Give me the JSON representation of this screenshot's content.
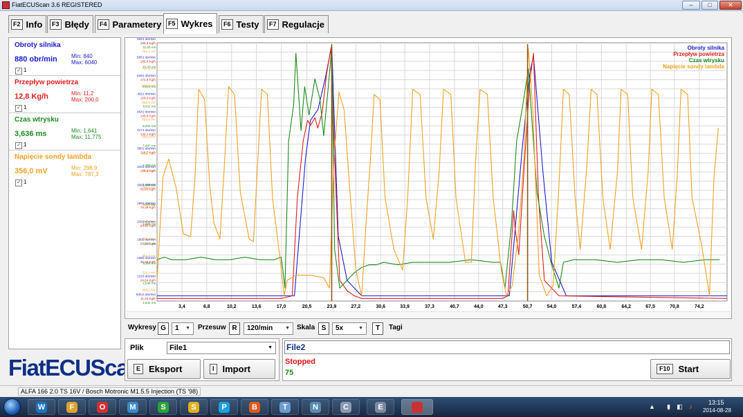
{
  "window": {
    "title": "FiatECUScan 3.6 REGISTERED",
    "controls": {
      "minimize": "–",
      "maximize": "□",
      "close": "✕"
    }
  },
  "tabs": [
    {
      "key": "F2",
      "label": "Info"
    },
    {
      "key": "F3",
      "label": "Błędy"
    },
    {
      "key": "F4",
      "label": "Parametery"
    },
    {
      "key": "F5",
      "label": "Wykres",
      "active": true
    },
    {
      "key": "F6",
      "label": "Testy"
    },
    {
      "key": "F7",
      "label": "Regulacje"
    }
  ],
  "params": [
    {
      "name": "Obroty silnika",
      "value": "880 obr/min",
      "min": "Min: 840",
      "max": "Max: 6040",
      "check": "✓",
      "index": "1",
      "color": "#1a1acc"
    },
    {
      "name": "Przepływ powietrza",
      "value": "12,8 Kg/h",
      "min": "Min: 11,2",
      "max": "Max: 200,0",
      "check": "✓",
      "index": "1",
      "color": "#e01c1c"
    },
    {
      "name": "Czas wtrysku",
      "value": "3,636 ms",
      "min": "Min: 1,641",
      "max": "Max: 11,775",
      "check": "✓",
      "index": "1",
      "color": "#1a8a1a"
    },
    {
      "name": "Napięcie sondy lambda",
      "value": "356,0 mV",
      "min": "Min: 298,9",
      "max": "Max: 787,3",
      "check": "✓",
      "index": "1",
      "color": "#f0a020"
    }
  ],
  "logo": "FiatECUScan",
  "chart_data": {
    "type": "line",
    "x_ticks": [
      "3,4",
      "6,8",
      "10,2",
      "13,6",
      "17,0",
      "20,5",
      "23,9",
      "27,2",
      "30,6",
      "33,9",
      "37,3",
      "40,7",
      "44,0",
      "47,3",
      "50,7",
      "54,0",
      "57,4",
      "60,8",
      "64,2",
      "67,5",
      "70,8",
      "74,2"
    ],
    "xlim": [
      0,
      78
    ],
    "y_axis": {
      "rpm": [
        "840,0 obr/min",
        "1210 obr/min",
        "1580 obr/min",
        "1950 obr/min",
        "2320 obr/min",
        "2691 obr/min",
        "3061 obr/min",
        "3431 obr/min",
        "3801 obr/min",
        "4171 obr/min",
        "4541 obr/min",
        "4911 obr/min",
        "5281 obr/min",
        "5651 obr/min",
        "6021 obr/min"
      ],
      "air": [
        "11,20 Kg/h",
        "24,64 Kg/h",
        "38,08 Kg/h",
        "51,51 Kg/h",
        "64,95 Kg/h",
        "78,39 Kg/h",
        "91,83 Kg/h",
        "105,3 Kg/h",
        "118,7 Kg/h",
        "132,1 Kg/h",
        "145,6 Kg/h",
        "159,0 Kg/h",
        "172,5 Kg/h",
        "185,9 Kg/h",
        "199,3 Kg/h"
      ],
      "inj": [
        "1,641 ms",
        "2,548 ms",
        "3,256 ms",
        "3,962 ms",
        "4,669 ms",
        "5,376 ms",
        "6,083 ms",
        "6,790 ms",
        "7,497 ms",
        "8,204 ms",
        "8,911 ms",
        "9,619 ms",
        "10,33 ms",
        "11,03 ms"
      ],
      "lambda": [
        "250,1 mV",
        "284,2 mV",
        "318,2 mV",
        "352,3 mV",
        "386,4 mV",
        "420,4 mV",
        "454,5 mV",
        "488,6 mV",
        "522,6 mV",
        "556,7 mV",
        "590,8 mV",
        "624,9 mV",
        "658,9 mV",
        "693,0 mV",
        "727,1 mV",
        "761,1 mV"
      ]
    },
    "legend": [
      "Obroty silnika",
      "Przepływ powietrza",
      "Czas wtrysku",
      "Napięcie sondy lambda"
    ],
    "legend_position": "top-right",
    "grid": true,
    "series": [
      {
        "name": "Obroty silnika",
        "color": "#1a1acc",
        "points": [
          [
            0,
            0.02
          ],
          [
            17,
            0.02
          ],
          [
            18.8,
            0.02
          ],
          [
            20.3,
            0.55
          ],
          [
            21,
            0.7
          ],
          [
            22,
            0.74
          ],
          [
            23,
            0.86
          ],
          [
            23.9,
            0.99
          ],
          [
            24.8,
            0.25
          ],
          [
            26,
            0.08
          ],
          [
            28,
            0.02
          ],
          [
            47,
            0.02
          ],
          [
            48.2,
            0.02
          ],
          [
            50,
            0.6
          ],
          [
            51,
            0.88
          ],
          [
            51.5,
            0.95
          ],
          [
            52.8,
            0.5
          ],
          [
            54,
            0.15
          ],
          [
            56,
            0.02
          ],
          [
            78,
            0.02
          ]
        ]
      },
      {
        "name": "Przepływ powietrza",
        "color": "#e01c1c",
        "points": [
          [
            0,
            0.01
          ],
          [
            17,
            0.01
          ],
          [
            18.5,
            0.02
          ],
          [
            19.2,
            0.4
          ],
          [
            20,
            0.62
          ],
          [
            20.6,
            0.7
          ],
          [
            21,
            0.68
          ],
          [
            21.6,
            0.71
          ],
          [
            22,
            0.67
          ],
          [
            22.6,
            0.73
          ],
          [
            23.2,
            0.88
          ],
          [
            23.8,
            0.98
          ],
          [
            24.3,
            0.55
          ],
          [
            25,
            0.08
          ],
          [
            26,
            0.04
          ],
          [
            27,
            0.02
          ],
          [
            28,
            0.01
          ],
          [
            47.3,
            0.01
          ],
          [
            48,
            0.02
          ],
          [
            48.8,
            0.35
          ],
          [
            49,
            0.28
          ],
          [
            49.5,
            0.18
          ],
          [
            50.2,
            0.5
          ],
          [
            51,
            0.85
          ],
          [
            51.5,
            0.96
          ],
          [
            52.2,
            0.4
          ],
          [
            53,
            0.08
          ],
          [
            55,
            0.02
          ],
          [
            78,
            0.01
          ]
        ]
      },
      {
        "name": "Czas wtrysku",
        "color": "#1a8a1a",
        "points": [
          [
            0,
            0.16
          ],
          [
            1,
            0.17
          ],
          [
            2,
            0.16
          ],
          [
            4,
            0.16
          ],
          [
            6,
            0.17
          ],
          [
            8,
            0.16
          ],
          [
            10,
            0.16
          ],
          [
            12,
            0.17
          ],
          [
            14,
            0.16
          ],
          [
            16,
            0.16
          ],
          [
            17,
            0.17
          ],
          [
            17.5,
            0.05
          ],
          [
            18,
            0.62
          ],
          [
            18.7,
            0.76
          ],
          [
            19,
            0.96
          ],
          [
            19.7,
            0.66
          ],
          [
            20.2,
            0.83
          ],
          [
            20.8,
            0.72
          ],
          [
            21.6,
            0.86
          ],
          [
            22.3,
            0.78
          ],
          [
            22.8,
            0.64
          ],
          [
            23.4,
            0.82
          ],
          [
            23.9,
            0.98
          ],
          [
            24.3,
            0.2
          ],
          [
            25,
            0.05
          ],
          [
            26,
            0.08
          ],
          [
            27,
            0.11
          ],
          [
            28,
            0.13
          ],
          [
            29,
            0.14
          ],
          [
            30,
            0.14
          ],
          [
            31,
            0.15
          ],
          [
            33,
            0.14
          ],
          [
            35,
            0.15
          ],
          [
            37,
            0.15
          ],
          [
            40,
            0.15
          ],
          [
            43,
            0.16
          ],
          [
            46,
            0.15
          ],
          [
            47,
            0.15
          ],
          [
            47.6,
            0.05
          ],
          [
            48.5,
            0.3
          ],
          [
            49.2,
            0.62
          ],
          [
            50,
            0.75
          ],
          [
            50.8,
            0.9
          ],
          [
            51.3,
            0.7
          ],
          [
            52,
            0.42
          ],
          [
            53,
            0.25
          ],
          [
            54,
            0.14
          ],
          [
            55,
            0.05
          ],
          [
            55.6,
            0.15
          ],
          [
            57,
            0.16
          ],
          [
            60,
            0.16
          ],
          [
            63,
            0.15
          ],
          [
            66,
            0.16
          ],
          [
            69,
            0.16
          ],
          [
            72,
            0.15
          ],
          [
            75,
            0.16
          ],
          [
            77,
            0.16
          ]
        ]
      },
      {
        "name": "Napięcie sondy lambda",
        "color": "#f0a020",
        "points": [
          [
            0,
            0.08
          ],
          [
            0.8,
            0.48
          ],
          [
            1.6,
            0.55
          ],
          [
            2.6,
            0.44
          ],
          [
            3.6,
            0.26
          ],
          [
            4.6,
            0.25
          ],
          [
            5.2,
            0.48
          ],
          [
            5.7,
            0.82
          ],
          [
            6.5,
            0.78
          ],
          [
            7.2,
            0.45
          ],
          [
            7.8,
            0.3
          ],
          [
            8.6,
            0.24
          ],
          [
            9.2,
            0.52
          ],
          [
            9.8,
            0.83
          ],
          [
            10.6,
            0.8
          ],
          [
            11.4,
            0.42
          ],
          [
            12.6,
            0.24
          ],
          [
            13.2,
            0.23
          ],
          [
            13.8,
            0.55
          ],
          [
            14.3,
            0.82
          ],
          [
            15.1,
            0.8
          ],
          [
            15.8,
            0.4
          ],
          [
            16.8,
            0.17
          ],
          [
            17.4,
            0.02
          ],
          [
            17.8,
            0.08
          ],
          [
            19,
            0.1
          ],
          [
            21,
            0.1
          ],
          [
            22.8,
            0.09
          ],
          [
            23.6,
            0.05
          ],
          [
            24.2,
            0.55
          ],
          [
            24.9,
            0.81
          ],
          [
            25.6,
            0.74
          ],
          [
            26.2,
            0.5
          ],
          [
            27.2,
            0.12
          ],
          [
            28,
            0.02
          ],
          [
            28.6,
            0.3
          ],
          [
            29.2,
            0.55
          ],
          [
            29.7,
            0.8
          ],
          [
            30.5,
            0.78
          ],
          [
            31.2,
            0.4
          ],
          [
            32.4,
            0.2
          ],
          [
            33.6,
            0.12
          ],
          [
            34.3,
            0.4
          ],
          [
            35,
            0.82
          ],
          [
            36,
            0.8
          ],
          [
            36.8,
            0.4
          ],
          [
            37.8,
            0.24
          ],
          [
            38.6,
            0.5
          ],
          [
            39.2,
            0.82
          ],
          [
            40.2,
            0.8
          ],
          [
            40.9,
            0.4
          ],
          [
            42.2,
            0.15
          ],
          [
            43,
            0.15
          ],
          [
            43.6,
            0.55
          ],
          [
            44.2,
            0.82
          ],
          [
            45.2,
            0.8
          ],
          [
            46,
            0.4
          ],
          [
            47.1,
            0.12
          ],
          [
            47.8,
            0.02
          ],
          [
            48.6,
            0.06
          ],
          [
            49.4,
            0.25
          ],
          [
            50.2,
            0.55
          ],
          [
            50.8,
            0.98
          ],
          [
            51.4,
            0.75
          ],
          [
            52.3,
            0.1
          ],
          [
            53.3,
            0.02
          ],
          [
            54.2,
            0.06
          ],
          [
            55,
            0.45
          ],
          [
            55.6,
            0.82
          ],
          [
            56.4,
            0.8
          ],
          [
            57.2,
            0.4
          ],
          [
            57.9,
            0.2
          ],
          [
            58.8,
            0.52
          ],
          [
            59.4,
            0.82
          ],
          [
            60.2,
            0.8
          ],
          [
            61,
            0.4
          ],
          [
            62,
            0.2
          ],
          [
            63,
            0.5
          ],
          [
            63.5,
            0.82
          ],
          [
            64.4,
            0.8
          ],
          [
            65.1,
            0.4
          ],
          [
            66.3,
            0.2
          ],
          [
            67.2,
            0.5
          ],
          [
            67.7,
            0.82
          ],
          [
            68.6,
            0.8
          ],
          [
            69.4,
            0.4
          ],
          [
            70.5,
            0.2
          ],
          [
            71.2,
            0.5
          ],
          [
            71.7,
            0.82
          ],
          [
            72.6,
            0.8
          ],
          [
            73.2,
            0.4
          ],
          [
            74.5,
            0.22
          ],
          [
            75.6,
            0.02
          ],
          [
            76.2,
            0.48
          ],
          [
            76.8,
            0.67
          ]
        ]
      }
    ]
  },
  "toolbar": {
    "wykresy_label": "Wykresy",
    "wykresy_key": "G",
    "wykresy_value": "1",
    "przesuw_label": "Przesuw",
    "przesuw_key": "R",
    "przesuw_value": "120/min",
    "skala_label": "Skala",
    "skala_key": "S",
    "skala_value": "5x",
    "tagi_key": "T",
    "tagi_label": "Tagi",
    "dropdown_arrow": "▼"
  },
  "file": {
    "label": "Plik",
    "selected": "File1",
    "export_key": "E",
    "export_label": "Eksport",
    "import_key": "I",
    "import_label": "Import"
  },
  "status": {
    "file2": "File2",
    "state": "Stopped",
    "count": "75",
    "start_key": "F10",
    "start_label": "Start"
  },
  "statusbar": {
    "text": "ALFA 166 2.0 TS 16V / Bosch Motronic M1.5.5 Injection (TS '98)"
  },
  "taskbar": {
    "items": [
      "W",
      "F",
      "O",
      "M",
      "S",
      "S",
      "P",
      "B",
      "T",
      "N",
      "C",
      "E"
    ],
    "clock_time": "13:15",
    "clock_date": "2014-08-28",
    "tray": [
      "▲",
      "▮",
      "◧",
      "♪"
    ]
  }
}
